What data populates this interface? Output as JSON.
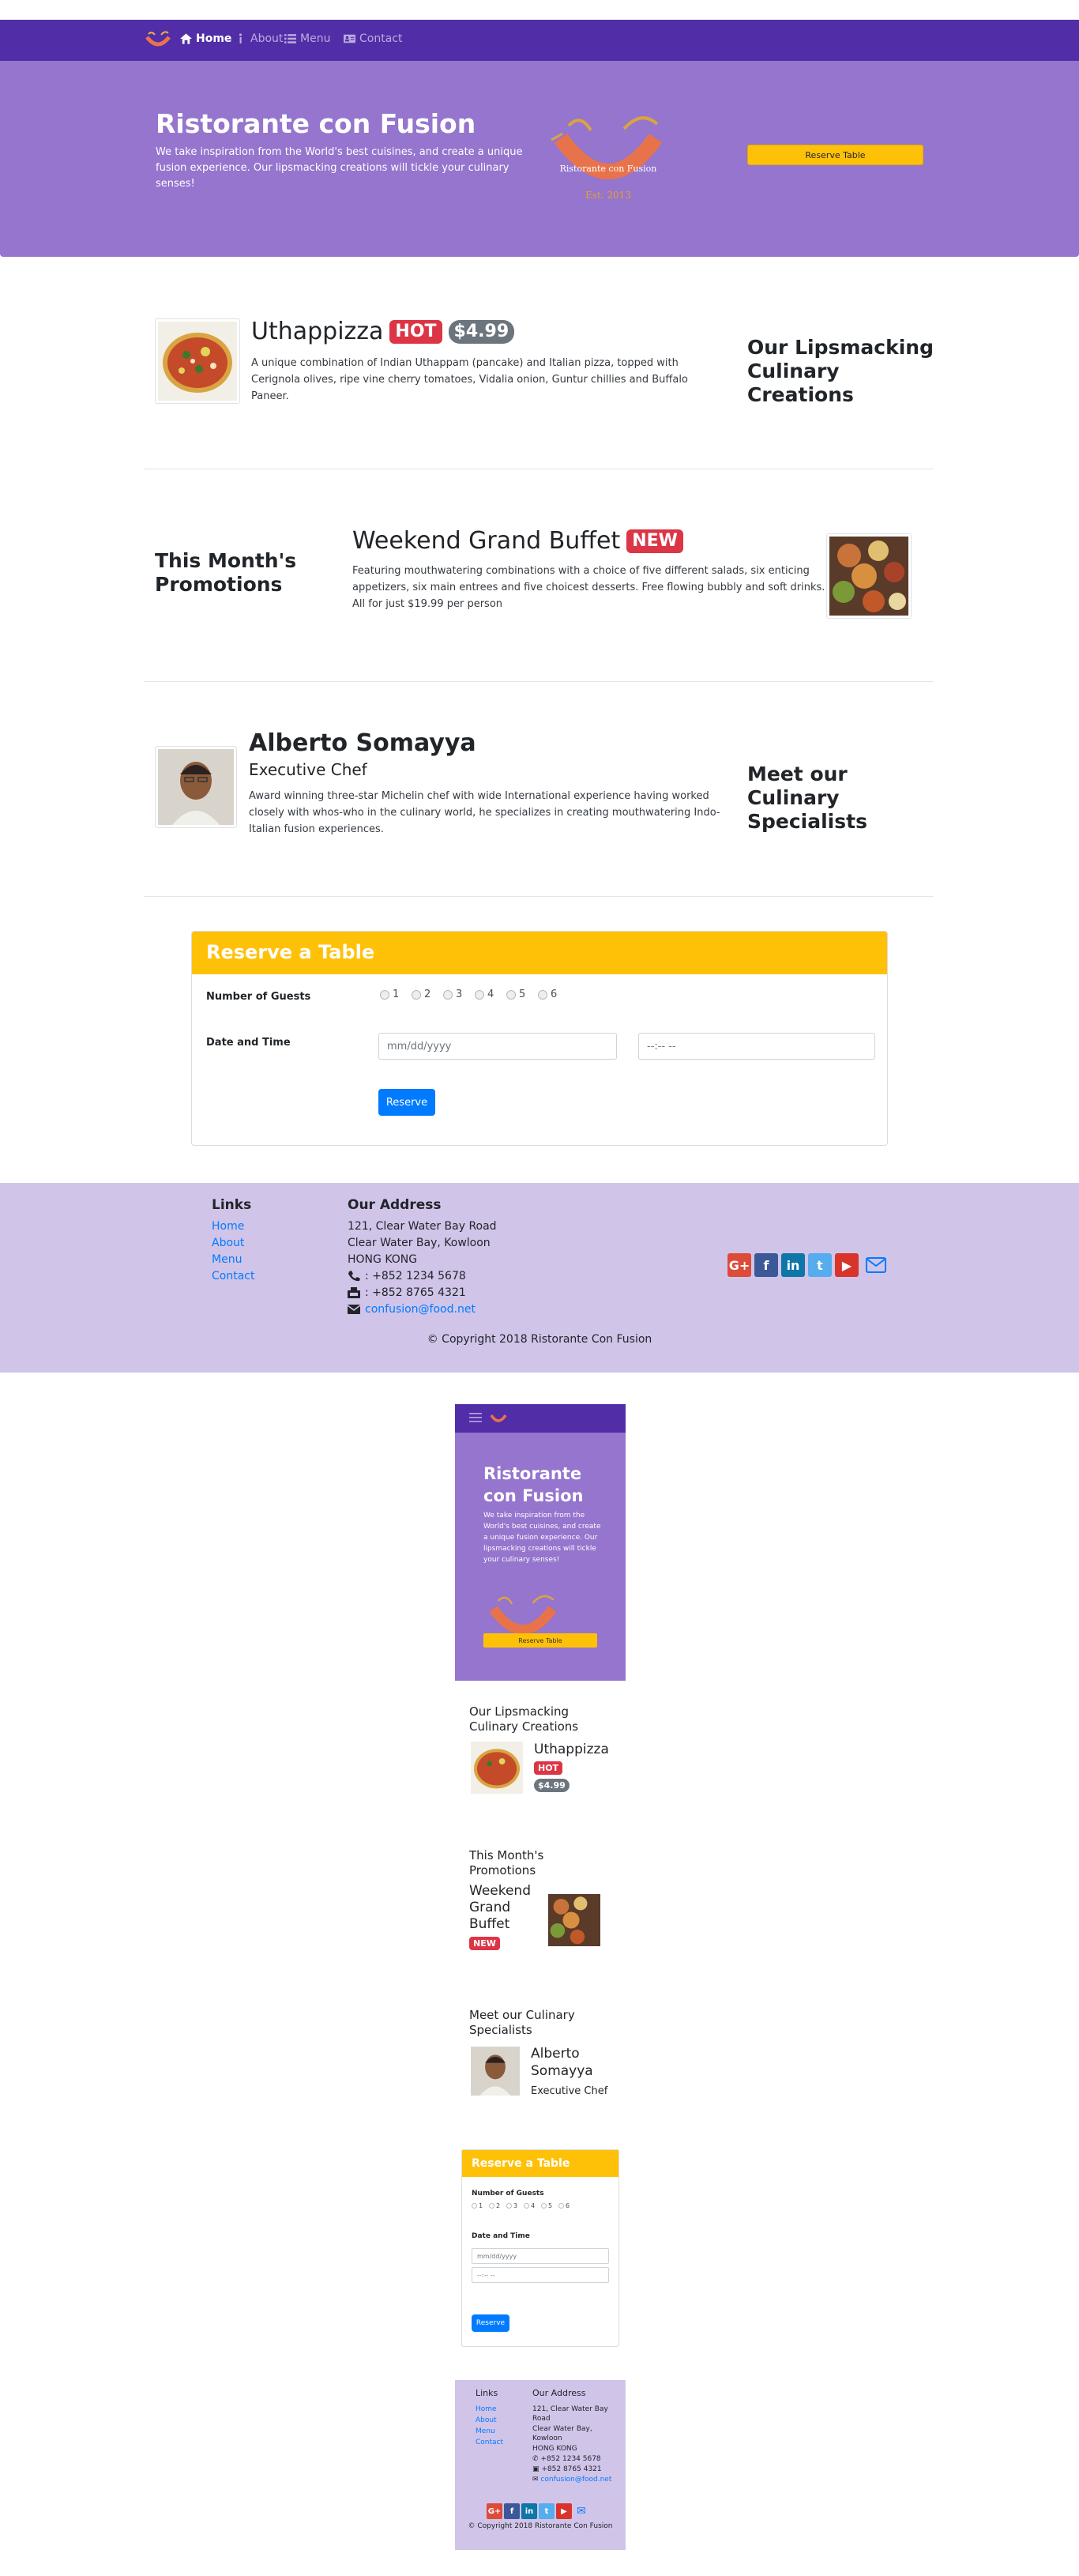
{
  "navbar": {
    "items": [
      {
        "label": "Home",
        "icon": "home-icon",
        "active": true
      },
      {
        "label": "About",
        "icon": "info-icon",
        "active": false
      },
      {
        "label": "Menu",
        "icon": "list-icon",
        "active": false
      },
      {
        "label": "Contact",
        "icon": "address-card-icon",
        "active": false
      }
    ]
  },
  "jumbotron": {
    "title": "Ristorante con Fusion",
    "text": "We take inspiration from the World's best cuisines, and create a unique fusion experience. Our lipsmacking creations will tickle your culinary senses!",
    "logo_text": "Ristorante con Fusion",
    "logo_est": "Est. 2013",
    "button": "Reserve Table"
  },
  "dish": {
    "title": "Uthappizza",
    "badge": "HOT",
    "price": "$4.99",
    "description": "A unique combination of Indian Uthappam (pancake) and Italian pizza, topped with Cerignola olives, ripe vine cherry tomatoes, Vidalia onion, Guntur chillies and Buffalo Paneer.",
    "section_heading": "Our Lipsmacking Culinary Creations"
  },
  "promotion": {
    "section_heading": "This Month's Promotions",
    "title": "Weekend Grand Buffet",
    "badge": "NEW",
    "description": "Featuring mouthwatering combinations with a choice of five different salads, six enticing appetizers, six main entrees and five choicest desserts. Free flowing bubbly and soft drinks. All for just $19.99 per person"
  },
  "leader": {
    "name": "Alberto Somayya",
    "designation": "Executive Chef",
    "description": "Award winning three-star Michelin chef with wide International experience having worked closely with whos-who in the culinary world, he specializes in creating mouthwatering Indo-Italian fusion experiences.",
    "section_heading": "Meet our Culinary Specialists"
  },
  "reserve": {
    "title": "Reserve a Table",
    "guests_label": "Number of Guests",
    "guests_options": [
      "1",
      "2",
      "3",
      "4",
      "5",
      "6"
    ],
    "datetime_label": "Date and Time",
    "date_placeholder": "mm/dd/yyyy",
    "time_placeholder": "--:-- --",
    "button": "Reserve"
  },
  "footer": {
    "links_heading": "Links",
    "links": [
      "Home",
      "About",
      "Menu",
      "Contact"
    ],
    "address_heading": "Our Address",
    "address": [
      "121, Clear Water Bay Road",
      "Clear Water Bay, Kowloon",
      "HONG KONG"
    ],
    "phone": ": +852 1234 5678",
    "fax": ": +852 8765 4321",
    "email": "confusion@food.net",
    "social": [
      "google-plus",
      "facebook",
      "linkedin",
      "twitter",
      "youtube",
      "mail"
    ],
    "copyright": "© Copyright 2018 Ristorante Con Fusion"
  },
  "mobile": {
    "title_line1": "Ristorante",
    "title_line2": "con Fusion",
    "text": "We take inspiration from the World's best cuisines, and create a unique fusion experience. Our lipsmacking creations will tickle your culinary senses!",
    "button": "Reserve Table",
    "dish_heading": "Our Lipsmacking Culinary Creations",
    "promo_heading": "This Month's Promotions",
    "promo_line1": "Weekend",
    "promo_line2": "Grand",
    "promo_line3": "Buffet",
    "leader_heading": "Meet our Culinary Specialists",
    "leader_line1": "Alberto",
    "leader_line2": "Somayya",
    "address_line1": "121, Clear Water Bay",
    "address_line2": "Road",
    "address_line3": "Clear Water Bay,",
    "address_line4": "Kowloon",
    "phone": "+852 1234 5678",
    "fax": "+852 8765 4321"
  },
  "colors": {
    "primary_dark": "#512da8",
    "primary_light": "#9575cd",
    "footer": "#d1c4e9",
    "warning": "#ffc107",
    "danger": "#dc3545",
    "link": "#007bff"
  }
}
